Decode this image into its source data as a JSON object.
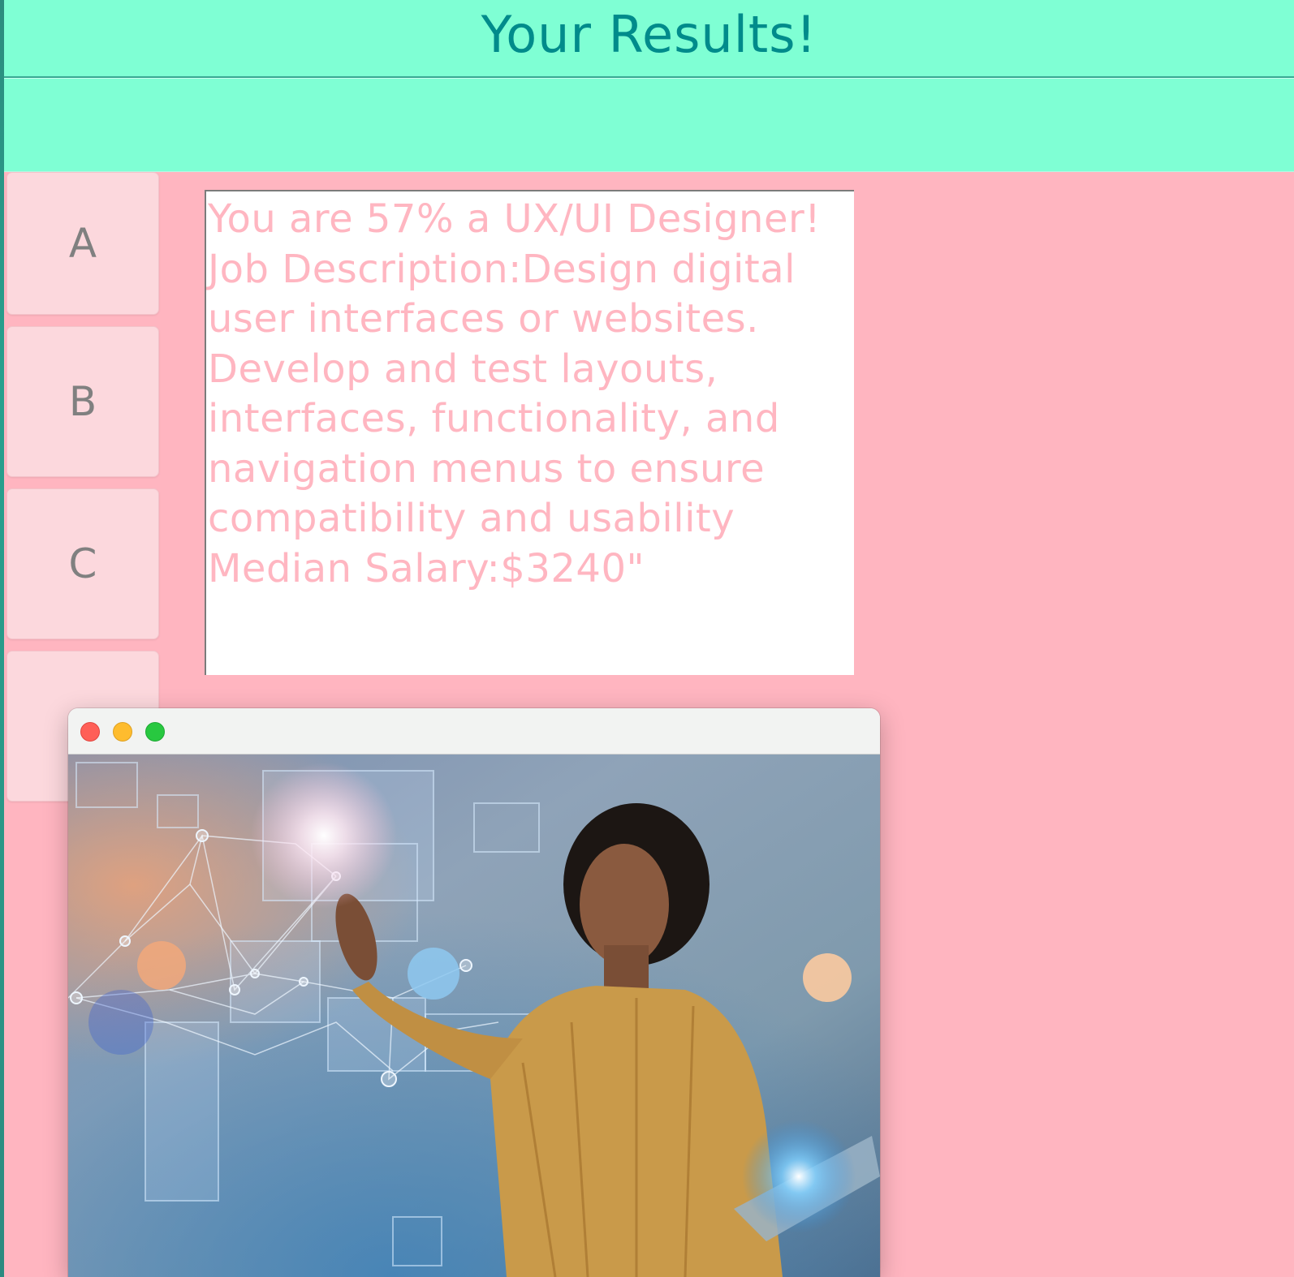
{
  "header": {
    "title": "Your Results!"
  },
  "answers": [
    {
      "label": "A"
    },
    {
      "label": "B"
    },
    {
      "label": "C"
    },
    {
      "label": ""
    }
  ],
  "result": {
    "text": "You are 57% a UX/UI Designer!\nJob Description:Design digital user interfaces or websites. Develop and test layouts, interfaces, functionality, and navigation menus to ensure compatibility and usability\nMedian Salary:$3240\""
  },
  "popup": {
    "image": "woman-interacting-with-holographic-interface-photo"
  },
  "colors": {
    "header_bg": "#7fffd4",
    "title_color": "#008b8b",
    "content_bg": "#ffb5c0",
    "result_text": "#ffb6c1",
    "button_bg": "#fcd8dd",
    "button_text": "#808080",
    "close": "#ff5f57",
    "minimize": "#febc2e",
    "maximize": "#28c840"
  }
}
